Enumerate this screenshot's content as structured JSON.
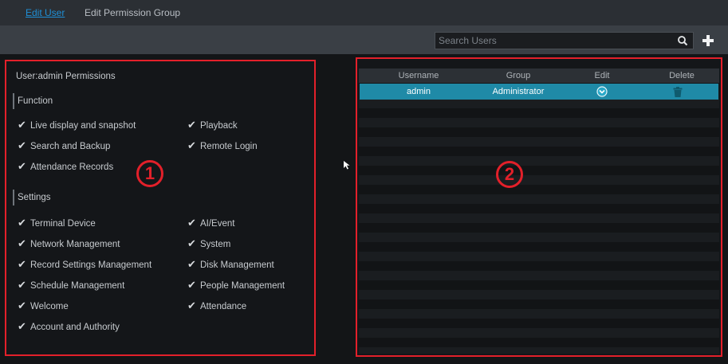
{
  "tabs": {
    "edit_user": "Edit User",
    "edit_permission_group": "Edit Permission Group"
  },
  "toolbar": {
    "search_placeholder": "Search Users",
    "search_icon": "search-icon",
    "add_icon": "plus-icon"
  },
  "permissions": {
    "title": "User:admin Permissions",
    "function_label": "Function",
    "settings_label": "Settings",
    "function_items": [
      "Live display and snapshot",
      "Playback",
      "Search and Backup",
      "Remote Login",
      "Attendance Records"
    ],
    "settings_items": [
      "Terminal Device",
      "AI/Event",
      "Network Management",
      "System",
      "Record Settings Management",
      "Disk Management",
      "Schedule Management",
      "People Management",
      "Welcome",
      "Attendance",
      "Account and Authority"
    ],
    "check_icon": "check-icon"
  },
  "users_table": {
    "headers": [
      "Username",
      "Group",
      "Edit",
      "Delete"
    ],
    "rows": [
      {
        "username": "admin",
        "group": "Administrator"
      }
    ],
    "edit_icon": "edit-chevron-icon",
    "delete_icon": "trash-icon"
  },
  "annotations": {
    "left_badge": "1",
    "right_badge": "2",
    "highlight_color": "#e3202a"
  },
  "colors": {
    "accent": "#1f8fd6",
    "selected_row": "#1f8aa7"
  }
}
